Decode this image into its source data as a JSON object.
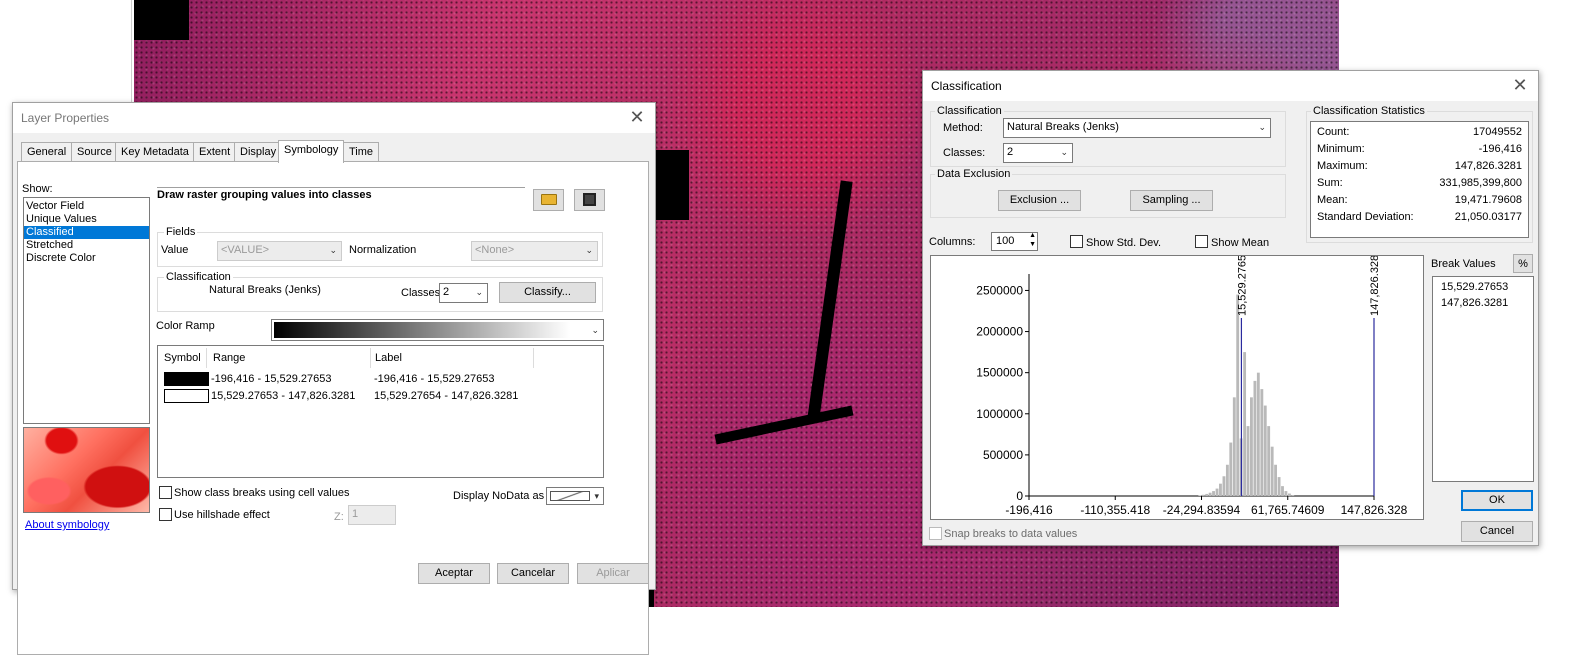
{
  "layer_props": {
    "title": "Layer Properties",
    "tabs": [
      "General",
      "Source",
      "Key Metadata",
      "Extent",
      "Display",
      "Symbology",
      "Time"
    ],
    "active_tab": "Symbology",
    "show_label": "Show:",
    "show_items": [
      "Vector Field",
      "Unique Values",
      "Classified",
      "Stretched",
      "Discrete Color"
    ],
    "selected_show": "Classified",
    "heading": "Draw raster grouping values into classes",
    "fields_label": "Fields",
    "value_label": "Value",
    "value_field": "<VALUE>",
    "normalization_label": "Normalization",
    "normalization_field": "<None>",
    "classification_label": "Classification",
    "method": "Natural Breaks (Jenks)",
    "classes_label": "Classes",
    "classes_value": "2",
    "classify_button": "Classify...",
    "color_ramp_label": "Color Ramp",
    "table_headers": [
      "Symbol",
      "Range",
      "Label"
    ],
    "table_rows": [
      {
        "range": "-196,416 - 15,529.27653",
        "label": "-196,416 - 15,529.27653",
        "color": "#000000"
      },
      {
        "range": "15,529.27653 - 147,826.3281",
        "label": "15,529.27654 - 147,826.3281",
        "color": "#ffffff"
      }
    ],
    "about_link": "About symbology",
    "show_class_breaks": "Show class breaks using cell values",
    "use_hillshade": "Use hillshade effect",
    "z_label": "Z:",
    "z_value": "1",
    "display_nodata": "Display NoData as",
    "buttons": {
      "ok": "Aceptar",
      "cancel": "Cancelar",
      "apply": "Aplicar"
    }
  },
  "classification": {
    "title": "Classification",
    "group_label": "Classification",
    "method_label": "Method:",
    "method_value": "Natural Breaks (Jenks)",
    "classes_label": "Classes:",
    "classes_value": "2",
    "data_exclusion_label": "Data Exclusion",
    "exclusion_button": "Exclusion ...",
    "sampling_button": "Sampling ...",
    "stats_label": "Classification Statistics",
    "stats": [
      {
        "k": "Count:",
        "v": "17049552"
      },
      {
        "k": "Minimum:",
        "v": "-196,416"
      },
      {
        "k": "Maximum:",
        "v": "147,826.3281"
      },
      {
        "k": "Sum:",
        "v": "331,985,399,800"
      },
      {
        "k": "Mean:",
        "v": "19,471.79608"
      },
      {
        "k": "Standard Deviation:",
        "v": "21,050.03177"
      }
    ],
    "columns_label": "Columns:",
    "columns_value": "100",
    "show_std_dev": "Show Std. Dev.",
    "show_mean": "Show Mean",
    "break_values_label": "Break Values",
    "percent_button": "%",
    "break_values": [
      "15,529.27653",
      "147,826.3281"
    ],
    "ok_button": "OK",
    "cancel_button": "Cancel",
    "snap_breaks": "Snap breaks to data values"
  },
  "chart_data": {
    "type": "bar",
    "title": "",
    "xlabel": "",
    "ylabel": "",
    "xlim": [
      -196416,
      147826.3281
    ],
    "ylim": [
      0,
      2700000
    ],
    "y_ticks": [
      0,
      500000,
      1000000,
      1500000,
      2000000,
      2500000
    ],
    "y_tick_labels": [
      "0",
      "500000",
      "1000000",
      "1500000",
      "2000000",
      "2500000"
    ],
    "x_ticks": [
      -196416,
      -110355.418,
      -24294.83594,
      61765.74609,
      147826.328
    ],
    "x_tick_labels": [
      "-196,416",
      "-110,355.418",
      "-24,294.83594",
      "61,765.74609",
      "147,826.328"
    ],
    "bin_width": 3442.42,
    "bins": [
      {
        "x": -27400,
        "y": 8000
      },
      {
        "x": -24000,
        "y": 15000
      },
      {
        "x": -20500,
        "y": 25000
      },
      {
        "x": -17100,
        "y": 40000
      },
      {
        "x": -13700,
        "y": 60000
      },
      {
        "x": -10200,
        "y": 90000
      },
      {
        "x": -6800,
        "y": 150000
      },
      {
        "x": -3300,
        "y": 240000
      },
      {
        "x": 100,
        "y": 380000
      },
      {
        "x": 3500,
        "y": 650000
      },
      {
        "x": 7000,
        "y": 1200000
      },
      {
        "x": 10400,
        "y": 2450000
      },
      {
        "x": 13800,
        "y": 700000
      },
      {
        "x": 17300,
        "y": 1750000
      },
      {
        "x": 20700,
        "y": 850000
      },
      {
        "x": 24100,
        "y": 1200000
      },
      {
        "x": 27600,
        "y": 1400000
      },
      {
        "x": 31000,
        "y": 1500000
      },
      {
        "x": 34500,
        "y": 1300000
      },
      {
        "x": 37900,
        "y": 1100000
      },
      {
        "x": 41300,
        "y": 850000
      },
      {
        "x": 44800,
        "y": 600000
      },
      {
        "x": 48200,
        "y": 380000
      },
      {
        "x": 51700,
        "y": 230000
      },
      {
        "x": 55100,
        "y": 120000
      },
      {
        "x": 58500,
        "y": 60000
      },
      {
        "x": 62000,
        "y": 30000
      },
      {
        "x": 65400,
        "y": 12000
      }
    ],
    "break_lines": [
      {
        "x": 15529.27653,
        "label": "15,529.27653"
      },
      {
        "x": 147826.3281,
        "label": "147,826.3281"
      }
    ]
  }
}
